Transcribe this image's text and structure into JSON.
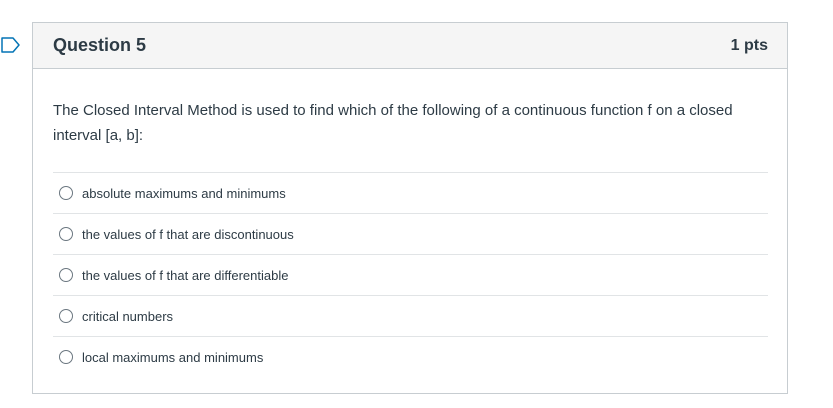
{
  "question": {
    "title": "Question 5",
    "points": "1 pts",
    "text": "The Closed Interval Method is used to find which of the following of a continuous function f on a closed interval [a, b]:",
    "answers": [
      {
        "label": "absolute maximums and minimums"
      },
      {
        "label": "the values of f that are discontinuous"
      },
      {
        "label": "the values of f that are differentiable"
      },
      {
        "label": "critical numbers"
      },
      {
        "label": "local maximums and minimums"
      }
    ]
  },
  "colors": {
    "flag": "#0374b5",
    "border": "#c7cdd1",
    "header_bg": "#f5f5f5",
    "text": "#2d3b45"
  },
  "icons": {
    "flag": "bookmark-flag-icon",
    "radio": "radio-button-icon"
  }
}
